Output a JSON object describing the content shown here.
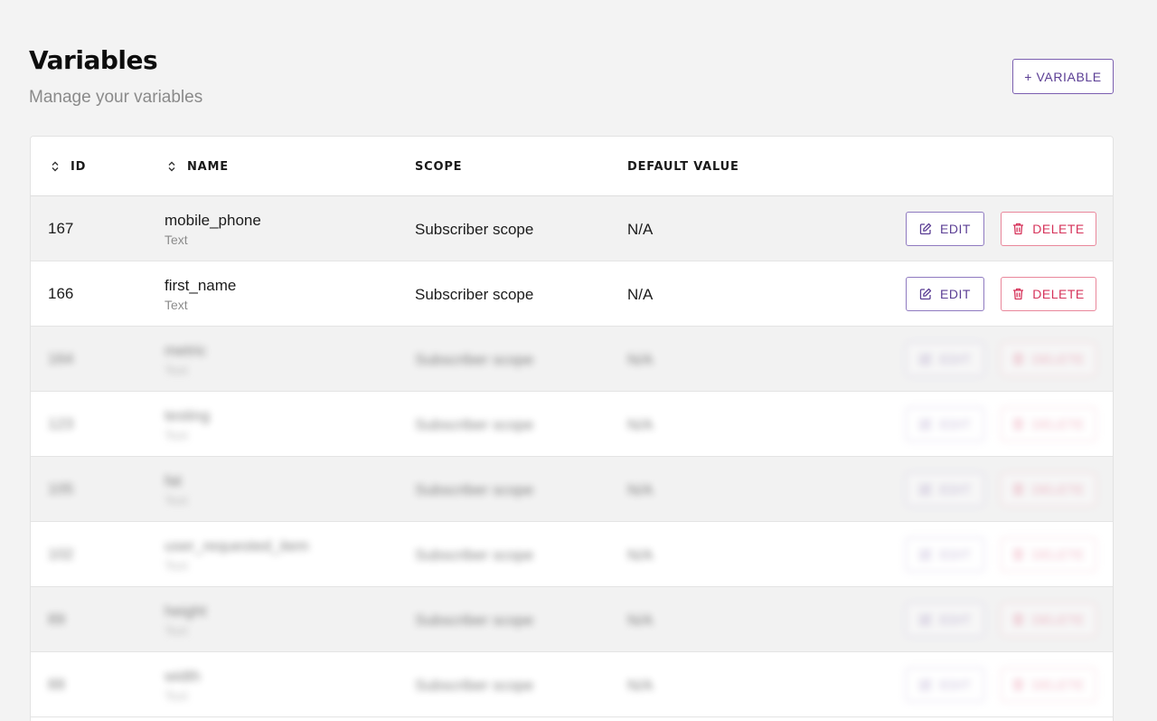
{
  "header": {
    "title": "Variables",
    "subtitle": "Manage your variables",
    "add_button_label": "+ VARIABLE"
  },
  "table": {
    "columns": {
      "id": "ID",
      "name": "NAME",
      "scope": "SCOPE",
      "default_value": "DEFAULT VALUE"
    },
    "edit_label": "EDIT",
    "delete_label": "DELETE",
    "rows": [
      {
        "id": "167",
        "name": "mobile_phone",
        "type": "Text",
        "scope": "Subscriber scope",
        "default_value": "N/A"
      },
      {
        "id": "166",
        "name": "first_name",
        "type": "Text",
        "scope": "Subscriber scope",
        "default_value": "N/A"
      },
      {
        "id": "164",
        "name": "metric",
        "type": "Text",
        "scope": "Subscriber scope",
        "default_value": "N/A"
      },
      {
        "id": "123",
        "name": "testing",
        "type": "Text",
        "scope": "Subscriber scope",
        "default_value": "N/A"
      },
      {
        "id": "105",
        "name": "fat",
        "type": "Text",
        "scope": "Subscriber scope",
        "default_value": "N/A"
      },
      {
        "id": "102",
        "name": "user_requested_item",
        "type": "Text",
        "scope": "Subscriber scope",
        "default_value": "N/A"
      },
      {
        "id": "89",
        "name": "height",
        "type": "Text",
        "scope": "Subscriber scope",
        "default_value": "N/A"
      },
      {
        "id": "88",
        "name": "width",
        "type": "Text",
        "scope": "Subscriber scope",
        "default_value": "N/A"
      }
    ]
  },
  "icons": {
    "sort": "sort-updown-icon",
    "edit": "pencil-edit-icon",
    "delete": "trash-icon"
  },
  "colors": {
    "accent": "#5b3e94",
    "danger": "#d6335a"
  }
}
